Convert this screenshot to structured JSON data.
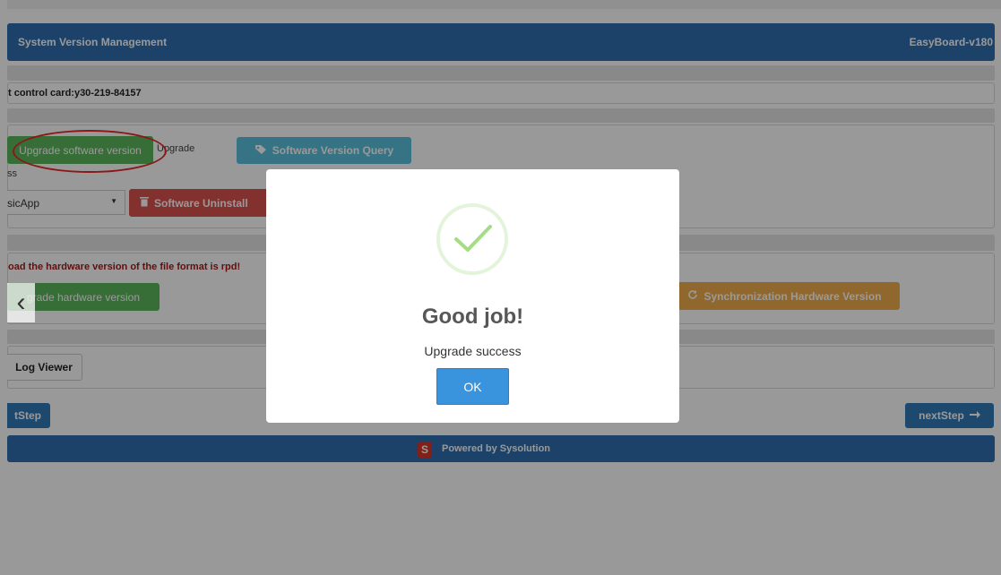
{
  "header": {
    "title": "System Version Management",
    "version": "EasyBoard-v180"
  },
  "control_card": {
    "label": "t control card:y30-219-84157"
  },
  "software": {
    "upgrade_button": "Upgrade software version",
    "upgrade_note": "Upgrade",
    "progress_label": "ss",
    "query_button": "Software Version Query",
    "app_select_value": "sicApp",
    "uninstall_button": "Software Uninstall"
  },
  "hardware": {
    "notice": "oad the hardware version of the file format is rpd!",
    "upgrade_button": "grade hardware version",
    "sync_button": "Synchronization Hardware Version"
  },
  "log": {
    "viewer_button": "Log Viewer"
  },
  "nav": {
    "prev_button": "tStep",
    "next_button": "nextStep"
  },
  "footer": {
    "text": "Powered by Sysolution",
    "logo_letter": "S"
  },
  "modal": {
    "title": "Good job!",
    "message": "Upgrade success",
    "ok_button": "OK"
  },
  "icons": {
    "tag": "tag-icon",
    "trash": "trash-icon",
    "refresh": "refresh-icon",
    "arrow_right": "arrow-right-icon",
    "success_check": "check-icon",
    "prev_slide": "chevron-left-icon"
  },
  "colors": {
    "header": "#2f6fb0",
    "success_green": "#5cb85c",
    "info_blue": "#5bc0de",
    "danger_red": "#d9534f",
    "warning_orange": "#f0ad4e",
    "ok_button": "#3a93dd",
    "highlight_ellipse": "#e8292b"
  }
}
